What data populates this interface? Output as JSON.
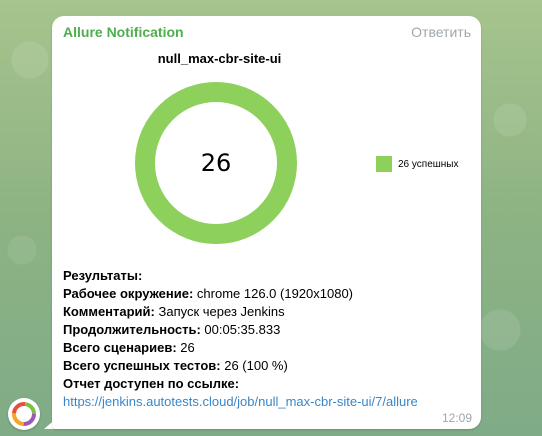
{
  "message": {
    "sender": "Allure Notification",
    "reply_label": "Ответить",
    "time": "12:09"
  },
  "chart_data": {
    "type": "pie",
    "title": "null_max-cbr-site-ui",
    "center_label": "26",
    "slices": [
      {
        "label": "26 успешных",
        "value": 26,
        "color": "#8dd05c"
      }
    ]
  },
  "results": {
    "heading": "Результаты:",
    "env_label": "Рабочее окружение:",
    "env_value": "chrome 126.0 (1920x1080)",
    "comment_label": "Комментарий:",
    "comment_value": "Запуск через Jenkins",
    "duration_label": "Продолжительность:",
    "duration_value": "00:05:35.833",
    "total_label": "Всего сценариев:",
    "total_value": "26",
    "passed_label": "Всего успешных тестов:",
    "passed_value": "26 (100 %)",
    "report_label": "Отчет доступен по ссылке:",
    "report_url": "https://jenkins.autotests.cloud/job/null_max-cbr-site-ui/7/allure"
  },
  "colors": {
    "sender": "#4fae4e",
    "link": "#3a86c8",
    "donut": "#8dd05c"
  }
}
